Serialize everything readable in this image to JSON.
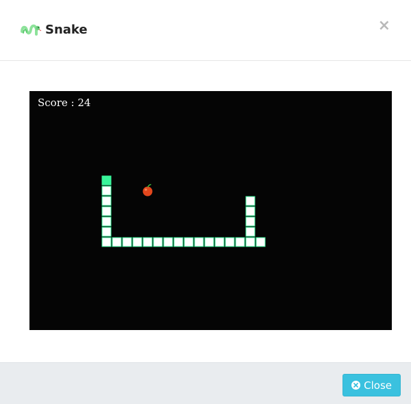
{
  "header": {
    "title": "Snake",
    "logo_icon": "snake-logo-icon",
    "close_symbol": "×"
  },
  "game": {
    "score_text": "Score : 24",
    "snake_color": "#39f59a",
    "snake_body_fill": "#ffffff",
    "background_color": "#050505",
    "grid": {
      "cols": 35,
      "rows": 23
    },
    "snake_head": [
      7,
      8
    ],
    "snake_body": [
      [
        7,
        9
      ],
      [
        7,
        10
      ],
      [
        7,
        11
      ],
      [
        7,
        12
      ],
      [
        7,
        13
      ],
      [
        7,
        14
      ],
      [
        8,
        14
      ],
      [
        9,
        14
      ],
      [
        10,
        14
      ],
      [
        11,
        14
      ],
      [
        12,
        14
      ],
      [
        13,
        14
      ],
      [
        14,
        14
      ],
      [
        15,
        14
      ],
      [
        16,
        14
      ],
      [
        17,
        14
      ],
      [
        18,
        14
      ],
      [
        19,
        14
      ],
      [
        20,
        14
      ],
      [
        21,
        14
      ],
      [
        22,
        14
      ],
      [
        21,
        13
      ],
      [
        21,
        12
      ],
      [
        21,
        11
      ],
      [
        21,
        10
      ]
    ],
    "apple": [
      11,
      9
    ],
    "apple_icon": "apple-icon"
  },
  "footer": {
    "close_label": "Close",
    "close_icon": "times-circle-icon",
    "button_color": "#3ac1df"
  }
}
